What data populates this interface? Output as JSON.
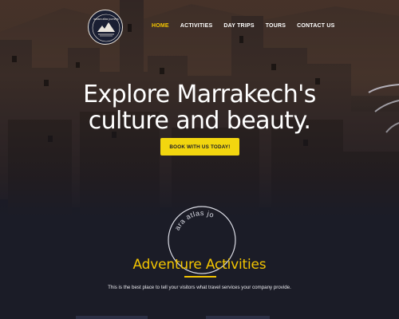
{
  "nav": {
    "items": [
      {
        "label": "HOME",
        "active": true
      },
      {
        "label": "ACTIVITIES",
        "active": false
      },
      {
        "label": "DAY TRIPS",
        "active": false
      },
      {
        "label": "TOURS",
        "active": false
      },
      {
        "label": "CONTACT US",
        "active": false
      }
    ]
  },
  "logo": {
    "text": "sahara atlas journeys"
  },
  "hero": {
    "headline_line1": "Explore Marrakech's",
    "headline_line2": "culture and beauty.",
    "cta_label": "BOOK WITH US TODAY!"
  },
  "badge": {
    "text": "ara atlas jo"
  },
  "section": {
    "title": "Adventure Activities",
    "description": "This is the best place to tell your visitors what travel services your company provide."
  },
  "colors": {
    "accent": "#f2c400",
    "cta_bg": "#f2d60f",
    "background": "#1b1c27",
    "text": "#ffffff"
  }
}
